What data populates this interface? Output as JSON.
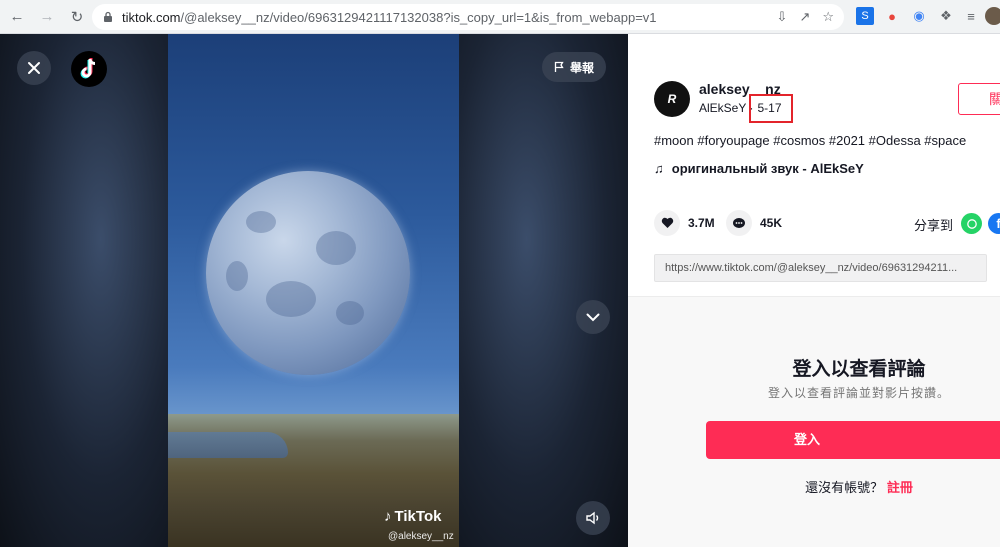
{
  "browser": {
    "url_host": "tiktok.com",
    "url_rest": "/@aleksey__nz/video/6963129421117132038?is_copy_url=1&is_from_webapp=v1"
  },
  "video": {
    "report_label": "舉報",
    "watermark_brand": "TikTok",
    "watermark_handle": "@aleksey__nz"
  },
  "author": {
    "username": "aleksey__nz",
    "nickname": "AlEkSeY",
    "separator": "·",
    "date": "5-17",
    "avatar_text": "R"
  },
  "follow_label": "關",
  "description": "#moon #foryoupage #cosmos #2021 #Odessa #space",
  "music": "оригинальный звук - AlEkSeY",
  "stats": {
    "likes": "3.7M",
    "comments": "45K"
  },
  "share_label": "分享到",
  "share_link": "https://www.tiktok.com/@aleksey__nz/video/69631294211...",
  "login": {
    "title": "登入以查看評論",
    "subtitle": "登入以查看評論並對影片按讚。",
    "button": "登入",
    "no_account": "還沒有帳號？",
    "signup": "註冊"
  },
  "colors": {
    "brand": "#fe2c55",
    "highlight_box": "#e3242b"
  }
}
